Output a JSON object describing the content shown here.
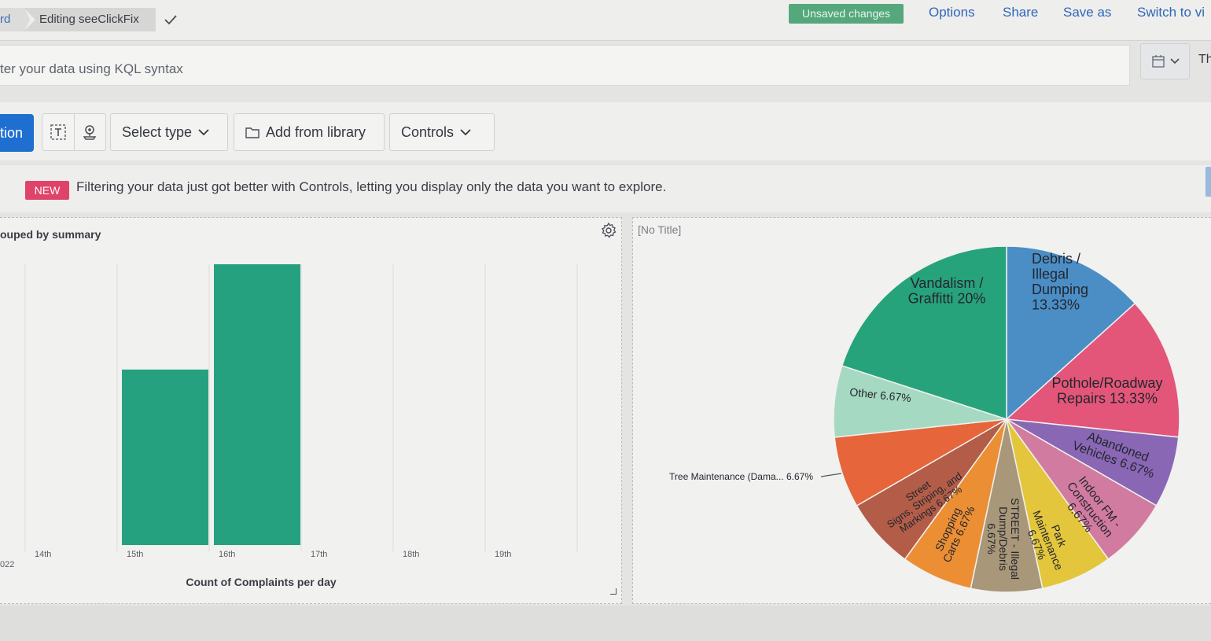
{
  "breadcrumb": {
    "previous": "rd",
    "current": "Editing seeClickFix"
  },
  "header": {
    "unsaved_badge": "Unsaved changes",
    "links": [
      "Options",
      "Share",
      "Save as",
      "Switch to vi"
    ]
  },
  "query": {
    "placeholder": "ter your data using KQL syntax",
    "date_text": "Th"
  },
  "toolbar": {
    "create_label": "tion",
    "select_type_label": "Select type",
    "add_library_label": "Add from library",
    "controls_label": "Controls"
  },
  "callout": {
    "badge": "NEW",
    "text": "Filtering your data just got better with Controls, letting you display only the data you want to explore."
  },
  "panels": {
    "left_title": "ouped by summary",
    "right_title": "[No Title]"
  },
  "colors": {
    "bar": "#26a180",
    "accent": "#1f6fd1",
    "success": "#55a87c",
    "new_badge": "#e0436a"
  },
  "chart_data": [
    {
      "type": "bar",
      "categories": [
        "14th",
        "15th",
        "16th",
        "17th",
        "18th",
        "19th"
      ],
      "values": [
        0,
        5,
        8,
        0,
        0,
        0
      ],
      "ylim": [
        0,
        8
      ],
      "x_extra_label": "022",
      "xlabel": "Count of Complaints per day",
      "ylabel": "",
      "grid": true
    },
    {
      "type": "pie",
      "title": "[No Title]",
      "slices": [
        {
          "lines": [
            "Debris /",
            "Illegal",
            "Dumping",
            "13.33%"
          ],
          "value": 13.33,
          "color": "#4b8ec6"
        },
        {
          "lines": [
            "Pothole/Roadway",
            "Repairs 13.33%"
          ],
          "value": 13.33,
          "color": "#e35679"
        },
        {
          "lines": [
            "Abandoned",
            "Vehicles 6.67%"
          ],
          "value": 6.67,
          "color": "#8a67b5"
        },
        {
          "lines": [
            "Indoor FM -",
            "Construction",
            "6.67%"
          ],
          "value": 6.67,
          "color": "#d27ba0"
        },
        {
          "lines": [
            "Park",
            "Maintenance",
            "6.67%"
          ],
          "value": 6.67,
          "color": "#e3c63c"
        },
        {
          "lines": [
            "STREET - Illegal",
            "Dump/Debris",
            "6.67%"
          ],
          "value": 6.67,
          "color": "#a9977a"
        },
        {
          "lines": [
            "Shopping",
            "Carts 6.67%"
          ],
          "value": 6.67,
          "color": "#ec8f34"
        },
        {
          "lines": [
            "Street",
            "Signs, Striping, and",
            "Markings 6.67%"
          ],
          "value": 6.67,
          "color": "#b35d48"
        },
        {
          "lines": [
            "Tree Maintenance (Dama...  6.67%"
          ],
          "value": 6.67,
          "color": "#e6653b"
        },
        {
          "lines": [
            "Other 6.67%"
          ],
          "value": 6.67,
          "color": "#a6d9c2"
        },
        {
          "lines": [
            "Vandalism /",
            "Graffitti 20%"
          ],
          "value": 20,
          "color": "#27a37c"
        }
      ]
    }
  ]
}
